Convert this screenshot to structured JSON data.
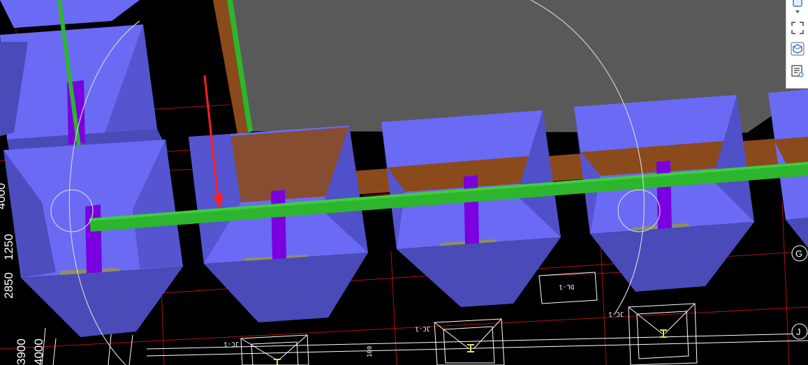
{
  "viewport": {
    "dimensions_left": [
      "4000",
      "1250",
      "2850",
      "3900",
      "4000"
    ],
    "labels": {
      "beam_dl": "DL-1",
      "footing_jc": "JC-1",
      "note_100": "100",
      "axis_g": "G",
      "axis_j": "J"
    }
  },
  "toolbar": {
    "items": [
      {
        "name": "view-cube-icon"
      },
      {
        "name": "dropdown-icon"
      },
      {
        "name": "full-extent-icon"
      },
      {
        "name": "3d-box-icon"
      },
      {
        "name": "properties-view-icon"
      }
    ]
  },
  "colors": {
    "background": "#000000",
    "slab": "#595959",
    "footing_top": "#6a6af5",
    "footing_side": "#4a4ab8",
    "column": "#7a00e0",
    "beam_green": "#2db52d",
    "beam_brown": "#8a4a1c",
    "grid_red": "#b01010",
    "cad_white": "#ffffff",
    "arrow_red": "#ff2020"
  }
}
